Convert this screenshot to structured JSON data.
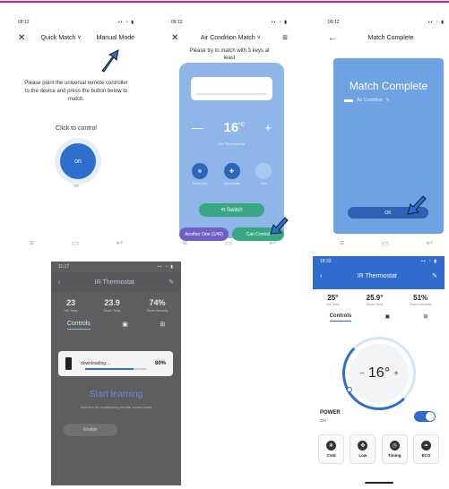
{
  "accent": "#d81b7c",
  "quick_match": {
    "status_time": "09:12",
    "close_icon": "✕",
    "title": "Quick Match ˅",
    "manual_mode": "Manual Mode",
    "instruction": "Please point the universal remote controller to the device and press the button below to match.",
    "click_to_control": "Click to control",
    "on_button": "on",
    "on_label": "on"
  },
  "ac_match": {
    "status_time": "09:12",
    "title": "Air Condition Match ˅",
    "subtitle": "Please try to match with 3 keys at least",
    "temperature": "16",
    "unit": "°C",
    "set_temperature": "Set Temperature",
    "modes": [
      {
        "label": "Mode cold"
      },
      {
        "label": "Speed auto"
      },
      {
        "label": "Mini"
      }
    ],
    "switch_label": "Switch",
    "another_one": "Another One (1/40)",
    "can_control": "Can Control"
  },
  "match_complete": {
    "status_time": "09:12",
    "title": "Match Complete",
    "heading": "Match Complete",
    "device_name": "Air Condition",
    "ok_button": "OK"
  },
  "learning": {
    "status_time": "11:17",
    "title": "IR Thermostat",
    "stats": [
      {
        "value": "23",
        "label": "Out Temp"
      },
      {
        "value": "23.9",
        "label": "Room Temp"
      },
      {
        "value": "74%",
        "label": "Room Humidity"
      }
    ],
    "tab_controls": "Controls",
    "download_text": "downloading...",
    "download_percent": "80%",
    "download_fraction": 0.8,
    "start_learning": "Start learning",
    "start_desc": "Start the air conditioning remote control learn",
    "enable": "Enable"
  },
  "thermostat": {
    "status_time": "18:32",
    "title": "IR Thermostat",
    "stats": [
      {
        "value": "25°",
        "label": "Out Temp"
      },
      {
        "value": "25.9°",
        "label": "Room Temp"
      },
      {
        "value": "51%",
        "label": "Room Humidity"
      }
    ],
    "tab_controls": "Controls",
    "temperature": "16°",
    "power_label": "POWER",
    "power_state": "ON",
    "buttons": [
      {
        "icon": "❄",
        "label": "Cold"
      },
      {
        "icon": "✤",
        "label": "Low"
      },
      {
        "icon": "◷",
        "label": "Timing"
      },
      {
        "icon": "❧",
        "label": "ECO"
      }
    ]
  }
}
